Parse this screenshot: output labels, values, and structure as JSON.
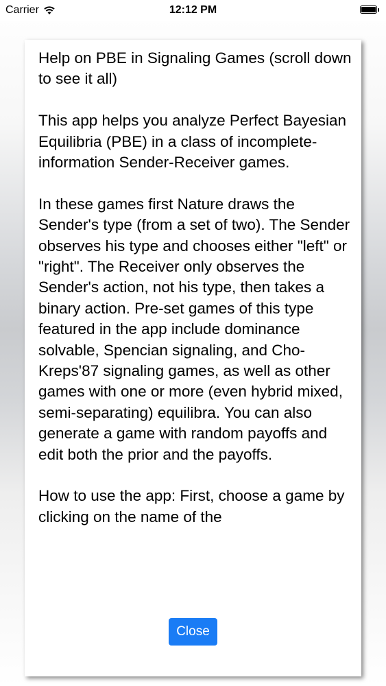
{
  "status_bar": {
    "carrier": "Carrier",
    "time": "12:12 PM",
    "wifi_icon": "wifi-icon",
    "battery_icon": "battery-icon",
    "battery_level": 1.0
  },
  "dialog": {
    "paragraphs": [
      "Help on PBE in Signaling Games (scroll down to see it all)",
      "This app helps you analyze Perfect Bayesian Equilibria (PBE) in a class of incomplete-information Sender-Receiver games.",
      "In these games first Nature draws the Sender's type (from a set of two). The Sender observes his type and chooses either \"left\" or \"right\". The Receiver only observes the Sender's action, not his type, then takes a binary action. Pre-set games of this type featured in the app include dominance solvable, Spencian signaling, and Cho-Kreps'87 signaling games, as well as other games with one or more (even hybrid mixed, semi-separating) equilibra. You can also generate a game with random payoffs and edit both the prior and the payoffs.",
      "How to use the app: First, choose a game by clicking on the name of the"
    ],
    "close_label": "Close",
    "accent_color": "#1a7cf5"
  }
}
